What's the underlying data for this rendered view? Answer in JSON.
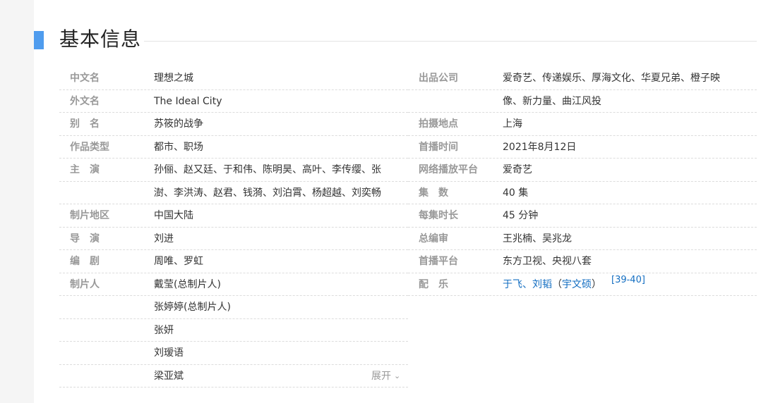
{
  "heading": "基本信息",
  "left_rows": [
    {
      "label": "中文名",
      "value": "理想之城"
    },
    {
      "label": "外文名",
      "value": "The Ideal City"
    },
    {
      "label": "别　名",
      "value": "苏筱的战争"
    },
    {
      "label": "作品类型",
      "value": "都市、职场"
    },
    {
      "label": "主　演",
      "value": "孙俪、赵又廷、于和伟、陈明昊、高叶、李传缨、张"
    },
    {
      "label": "",
      "value": "澍、李洪涛、赵君、钱漪、刘泊霄、杨超越、刘奕畅"
    },
    {
      "label": "制片地区",
      "value": "中国大陆"
    },
    {
      "label": "导　演",
      "value": "刘进"
    },
    {
      "label": "编　剧",
      "value": "周唯、罗虹"
    },
    {
      "label": "制片人",
      "value": "戴莹(总制片人)"
    },
    {
      "label": "",
      "value": "张婷婷(总制片人)"
    },
    {
      "label": "",
      "value": "张妍"
    },
    {
      "label": "",
      "value": "刘瑷语"
    },
    {
      "label": "",
      "value": "梁亚斌"
    }
  ],
  "right_rows": [
    {
      "label": "出品公司",
      "value": "爱奇艺、传递娱乐、厚海文化、华夏兄弟、橙子映"
    },
    {
      "label": "",
      "value": "像、新力量、曲江风投"
    },
    {
      "label": "拍摄地点",
      "value": "上海"
    },
    {
      "label": "首播时间",
      "value": "2021年8月12日"
    },
    {
      "label": "网络播放平台",
      "value": "爱奇艺"
    },
    {
      "label": "集　数",
      "value": "40 集"
    },
    {
      "label": "每集时长",
      "value": "45 分钟"
    },
    {
      "label": "总编审",
      "value": "王兆楠、吴兆龙"
    },
    {
      "label": "首播平台",
      "value": "东方卫视、央视八套"
    }
  ],
  "music": {
    "label": "配　乐",
    "link1": "于飞",
    "sep": "、",
    "link2": "刘韬",
    "paren_open": "（",
    "link3": "宇文硕",
    "paren_close": "）",
    "ref": "[39-40]"
  },
  "expand_label": "展开",
  "expand_icon": "chevron-down-icon"
}
